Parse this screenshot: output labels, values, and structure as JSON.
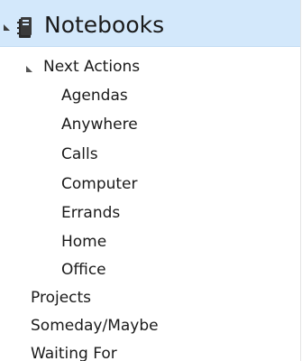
{
  "tree": {
    "root": {
      "label": "Notebooks",
      "icon": "notebook-icon",
      "expanded": true
    },
    "next_actions": {
      "label": "Next Actions",
      "expanded": true
    },
    "contexts": [
      {
        "label": "Agendas"
      },
      {
        "label": "Anywhere"
      },
      {
        "label": "Calls"
      },
      {
        "label": "Computer"
      },
      {
        "label": "Errands"
      },
      {
        "label": "Home"
      },
      {
        "label": "Office"
      }
    ],
    "others": [
      {
        "label": "Projects"
      },
      {
        "label": "Someday/Maybe"
      },
      {
        "label": "Waiting For"
      }
    ]
  },
  "colors": {
    "selection": "#d3e8fb",
    "text": "#1a1a1a"
  }
}
